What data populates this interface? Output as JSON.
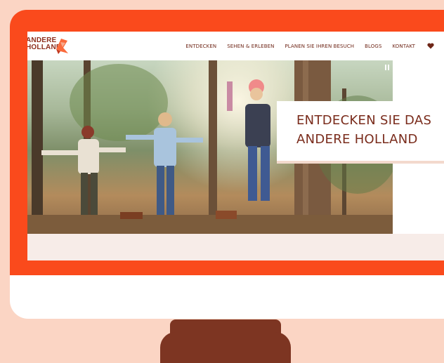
{
  "site": {
    "logo_line1": "ANDERE",
    "logo_line2": "HOLLAND"
  },
  "nav": {
    "items": [
      {
        "label": "ENTDECKEN"
      },
      {
        "label": "SEHEN & ERLEBEN"
      },
      {
        "label": "PLANEN SIE IHREN BESUCH"
      },
      {
        "label": "BLOGS"
      },
      {
        "label": "KONTAKT"
      }
    ],
    "favorites_icon": "heart-icon"
  },
  "hero": {
    "heading_line1": "ENTDECKEN SIE DAS",
    "heading_line2": "ANDERE HOLLAND",
    "slideshow_icon": "pause-icon"
  },
  "colors": {
    "page_background": "#fbd5c4",
    "monitor_frame": "#fa4a1c",
    "stand": "#7d3522",
    "brand_text": "#7a2c1c"
  }
}
